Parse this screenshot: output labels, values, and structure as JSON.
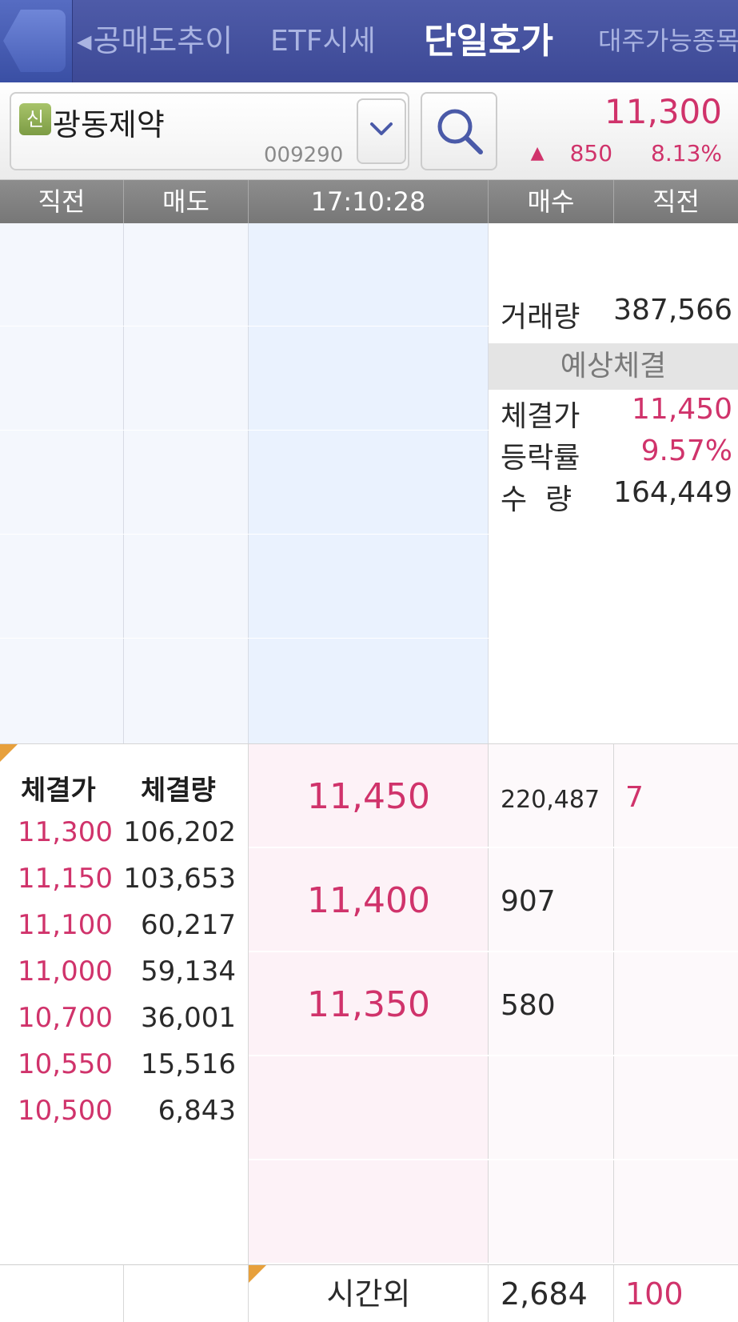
{
  "nav": {
    "tabs": [
      {
        "label": "공매도추이"
      },
      {
        "label": "ETF시세"
      },
      {
        "label": "단일호가",
        "active": true
      },
      {
        "label": "대주가능종목"
      }
    ]
  },
  "stock": {
    "badge": "신",
    "name": "광동제약",
    "code": "009290",
    "price": "11,300",
    "change_arrow": "▲",
    "change": "850",
    "change_pct": "8.13%"
  },
  "columns": {
    "prev_left": "직전",
    "sell": "매도",
    "time": "17:10:28",
    "buy": "매수",
    "prev_right": "직전"
  },
  "info": {
    "volume_label": "거래량",
    "volume": "387,566",
    "expected_header": "예상체결",
    "exp_price_label": "체결가",
    "exp_price": "11,450",
    "exp_rate_label": "등락률",
    "exp_rate": "9.57%",
    "exp_qty_label": "수  량",
    "exp_qty": "164,449"
  },
  "trades": {
    "price_header": "체결가",
    "volume_header": "체결량",
    "rows": [
      {
        "price": "11,300",
        "volume": "106,202"
      },
      {
        "price": "11,150",
        "volume": "103,653"
      },
      {
        "price": "11,100",
        "volume": "60,217"
      },
      {
        "price": "11,000",
        "volume": "59,134"
      },
      {
        "price": "10,700",
        "volume": "36,001"
      },
      {
        "price": "10,550",
        "volume": "15,516"
      },
      {
        "price": "10,500",
        "volume": "6,843"
      }
    ]
  },
  "bids": [
    {
      "price": "11,450",
      "qty": "220,487",
      "prev": "7"
    },
    {
      "price": "11,400",
      "qty": "907",
      "prev": ""
    },
    {
      "price": "11,350",
      "qty": "580",
      "prev": ""
    },
    {
      "price": "",
      "qty": "",
      "prev": ""
    },
    {
      "price": "",
      "qty": "",
      "prev": ""
    }
  ],
  "after_hours": {
    "label": "시간외",
    "qty": "2,684",
    "prev": "100"
  },
  "colors": {
    "accent_red": "#d0336b",
    "nav_blue": "#4e5ba8",
    "header_gray": "#808080"
  }
}
